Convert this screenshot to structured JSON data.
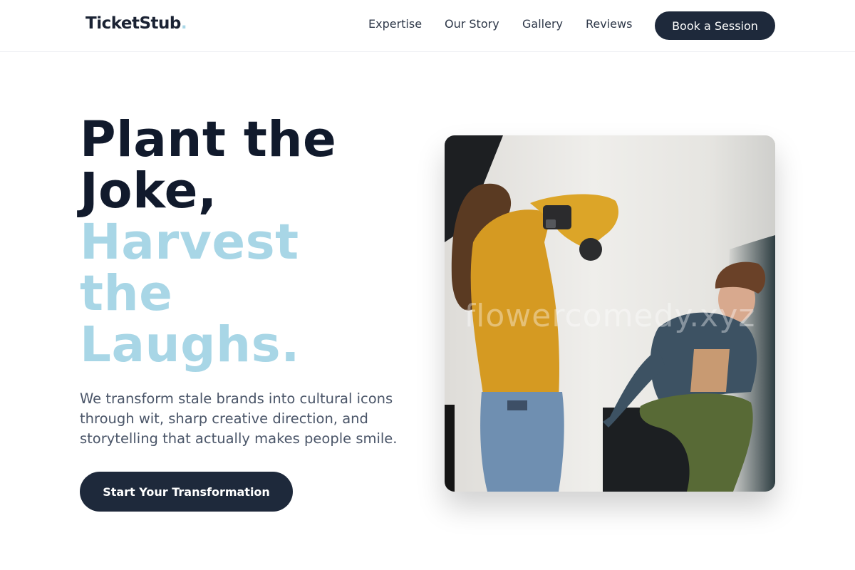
{
  "header": {
    "logo_text": "TicketStub",
    "logo_dot": ".",
    "nav": [
      "Expertise",
      "Our Story",
      "Gallery",
      "Reviews"
    ],
    "book_label": "Book a Session"
  },
  "hero": {
    "title_dark": [
      "Plant the",
      "Joke,"
    ],
    "title_light": [
      "Harvest",
      "the",
      "Laughs."
    ],
    "description": "We transform stale brands into cultural icons through wit, sharp creative direction, and storytelling that actually makes people smile.",
    "cta_label": "Start Your Transformation"
  },
  "photo": {
    "watermark": "flowercomedy.xyz"
  },
  "colors": {
    "primary": "#1e293b",
    "accent": "#a8d6e6",
    "heading": "#111a2c",
    "body_text": "#4a5568"
  }
}
